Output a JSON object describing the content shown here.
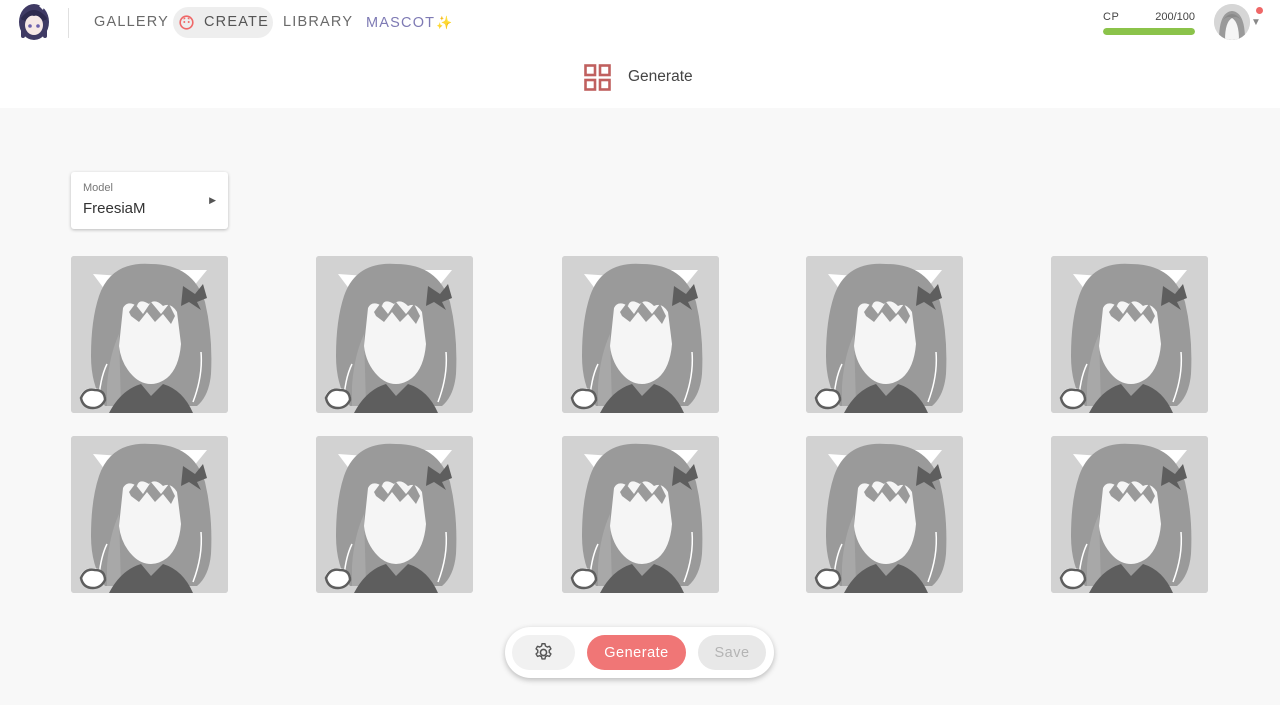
{
  "nav": {
    "gallery": "GALLERY",
    "create": "CREATE",
    "library": "LIBRARY",
    "mascot": "MASCOT",
    "mascot_icon": "sparkle-icon"
  },
  "cp": {
    "label": "CP",
    "value": "200/100",
    "fill_fraction": 1.0,
    "color": "#8bc34a"
  },
  "page": {
    "title": "Generate",
    "title_icon": "grid-icon",
    "accent": "#c0605f"
  },
  "model": {
    "label": "Model",
    "value": "FreesiaM"
  },
  "thumbnails": {
    "count": 10,
    "placeholder": "anime-girl-silhouette"
  },
  "actions": {
    "settings_icon": "gear-icon",
    "generate": "Generate",
    "save": "Save",
    "generate_color": "#f07676"
  }
}
